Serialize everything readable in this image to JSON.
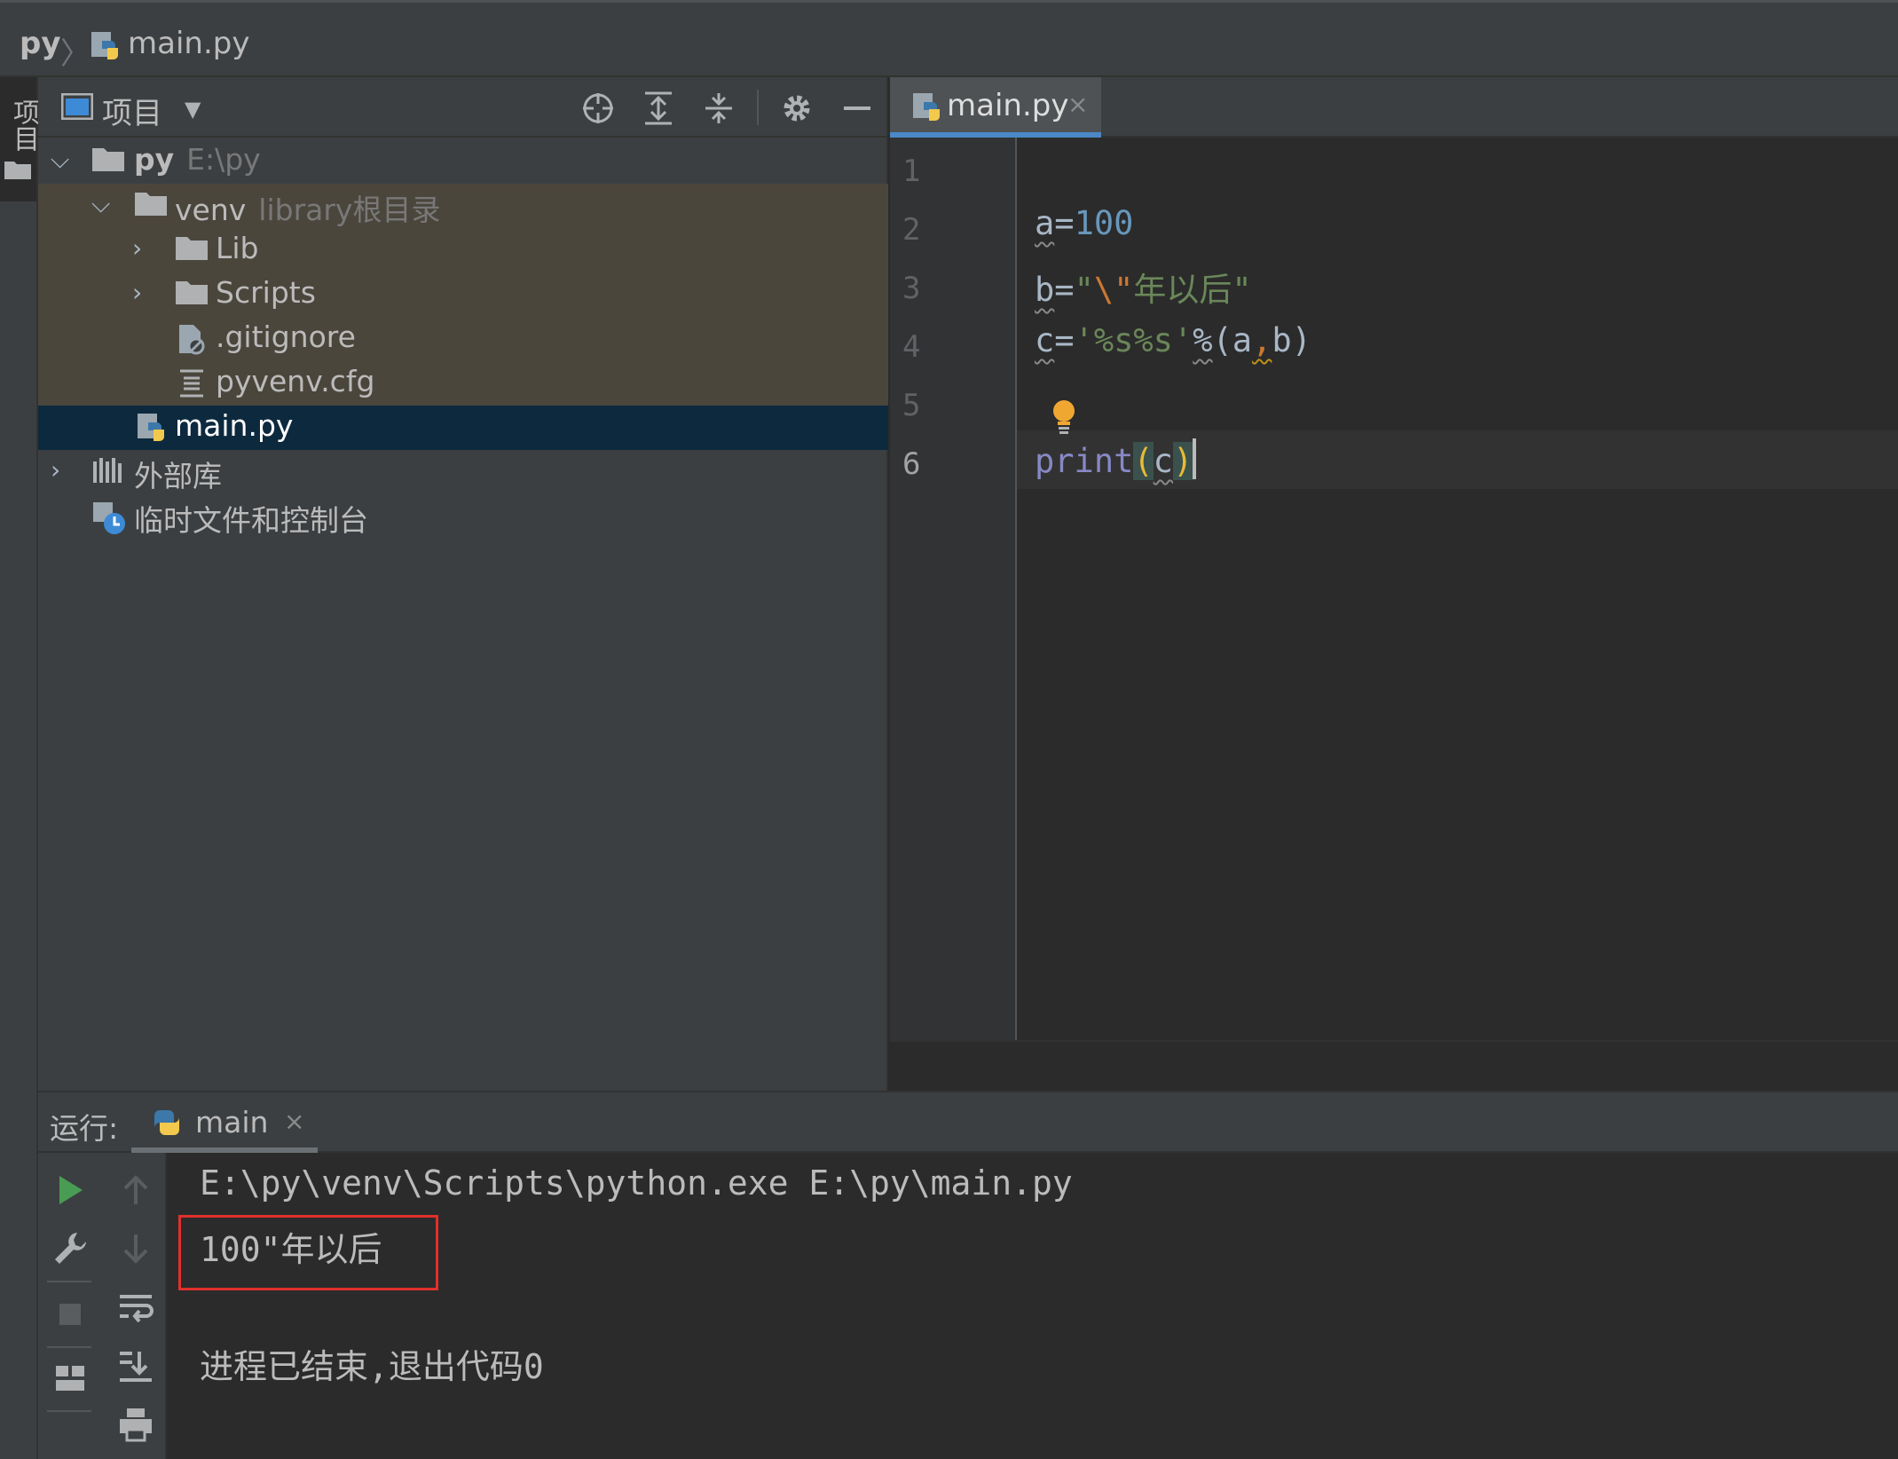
{
  "breadcrumb": {
    "root": "py",
    "separator": "〉",
    "file": "main.py"
  },
  "left_strip": {
    "project_tab_label": "项目"
  },
  "project_panel": {
    "title": "项目",
    "tools": [
      "locate-icon",
      "expand-all-icon",
      "collapse-all-icon",
      "gear-icon",
      "minimize-icon"
    ],
    "tree": [
      {
        "label": "py",
        "hint": "E:\\py",
        "type": "folder",
        "expanded": true
      },
      {
        "label": "venv",
        "hint": "library根目录",
        "type": "folder",
        "expanded": true
      },
      {
        "label": "Lib",
        "type": "folder",
        "expanded": false
      },
      {
        "label": "Scripts",
        "type": "folder",
        "expanded": false
      },
      {
        "label": ".gitignore",
        "type": "ignore-file"
      },
      {
        "label": "pyvenv.cfg",
        "type": "config-file"
      },
      {
        "label": "main.py",
        "type": "python-file",
        "selected": true
      },
      {
        "label": "外部库",
        "type": "library",
        "expanded": false
      },
      {
        "label": "临时文件和控制台",
        "type": "scratches"
      }
    ]
  },
  "editor": {
    "tab_label": "main.py",
    "tab_close": "×",
    "line_numbers": [
      "1",
      "2",
      "3",
      "4",
      "5",
      "6"
    ],
    "current_line": "6",
    "code": {
      "l2": {
        "var": "a",
        "op": "=",
        "num": "100"
      },
      "l3": {
        "var": "b",
        "op": "=",
        "q1": "\"",
        "esc": "\\\"",
        "text": "年以后",
        "q2": "\""
      },
      "l4": {
        "var": "c",
        "op": "=",
        "str": "'%s%s'",
        "mod": "%",
        "open": "(",
        "a": "a",
        "comma": ",",
        "b": "b",
        "close": ")"
      },
      "l6": {
        "fn": "print",
        "open": "(",
        "arg": "c",
        "close": ")"
      }
    }
  },
  "run_panel": {
    "title": "运行:",
    "tab_label": "main",
    "tab_close": "×",
    "console": [
      "E:\\py\\venv\\Scripts\\python.exe E:\\py\\main.py",
      "100\"年以后",
      "",
      "进程已结束,退出代码0"
    ]
  },
  "colors": {
    "selection": "#0d293e",
    "library_root_bg": "#4b463c",
    "tab_accent": "#4a88c7",
    "highlight_box": "#e0302c"
  }
}
